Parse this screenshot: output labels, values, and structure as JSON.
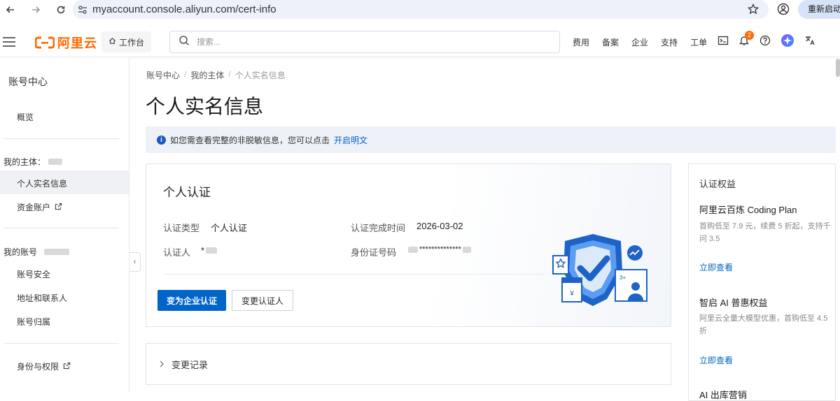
{
  "browser": {
    "url": "myaccount.console.aliyun.com/cert-info",
    "restart_label": "重新启动"
  },
  "topbar": {
    "logo_text": "阿里云",
    "workbench_label": "工作台",
    "search_placeholder": "搜索...",
    "links": [
      "费用",
      "备案",
      "企业",
      "支持",
      "工单"
    ],
    "notification_count": "2",
    "brand_color": "#ff6a00"
  },
  "sidebar": {
    "title": "账号中心",
    "overview": "概览",
    "my_entity_label": "我的主体：",
    "personal_info": "个人实名信息",
    "fund_account": "资金账户",
    "my_account_label": "我的账号",
    "account_security": "账号安全",
    "address_contacts": "地址和联系人",
    "account_ownership": "账号归属",
    "identity_permissions": "身份与权限"
  },
  "breadcrumb": [
    "账号中心",
    "我的主体",
    "个人实名信息"
  ],
  "page_title": "个人实名信息",
  "notice": {
    "text": "如您需查看完整的非脱敏信息，您可以点击",
    "link": "开启明文"
  },
  "cert_card": {
    "title": "个人认证",
    "type_label": "认证类型",
    "type_value": "个人认证",
    "time_label": "认证完成时间",
    "time_value": "2026-03-02",
    "person_label": "认证人",
    "person_value": "*",
    "id_label": "身份证号码",
    "id_value": "**************",
    "primary_button": "变为企业认证",
    "secondary_button": "变更认证人",
    "accent_color": "#0064c8"
  },
  "record": {
    "label": "变更记录"
  },
  "benefits": {
    "title": "认证权益",
    "items": [
      {
        "heading": "阿里云百炼 Coding Plan",
        "desc": "首购低至 7.9 元，续费 5 折起，支持千问 3.5",
        "link": "立即查看"
      },
      {
        "heading": "智启 AI 普惠权益",
        "desc": "阿里云全量大模型优惠，首购低至 4.5 折",
        "link": "立即查看"
      }
    ],
    "cut_off_heading": "AI 出库营销"
  }
}
